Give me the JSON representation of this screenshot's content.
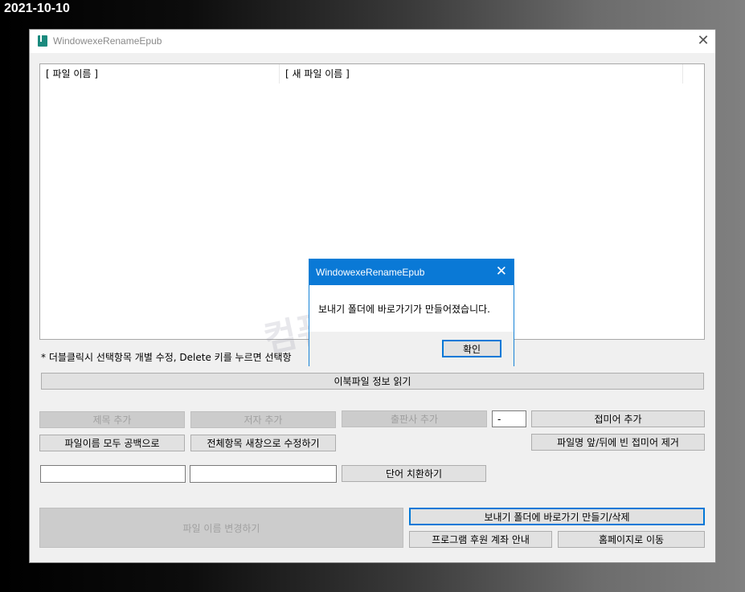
{
  "date_label": "2021-10-10",
  "window": {
    "title": "WindowexeRenameEpub",
    "close_glyph": "✕"
  },
  "listview": {
    "columns": [
      "[ 파일 이름 ]",
      "[ 새 파일 이름 ]"
    ]
  },
  "hint_text": "* 더블클릭시 선택항목 개별 수정, Delete 키를 누르면 선택항",
  "buttons": {
    "read_ebook_info": "이북파일 정보 읽기",
    "add_title": "제목 추가",
    "add_author": "저자 추가",
    "add_publisher": "출판사 추가",
    "add_suffix": "접미어 추가",
    "all_spaces": "파일이름 모두 공백으로",
    "edit_all_new_window": "전체항목 새창으로 수정하기",
    "remove_empty_suffix": "파일명 앞/뒤에 빈 접미어 제거",
    "replace_word": "단어 치환하기",
    "rename_files": "파일 이름 변경하기",
    "sendto_shortcut": "보내기 폴더에 바로가기 만들기/삭제",
    "donation_info": "프로그램 후원 계좌 안내",
    "go_homepage": "홈페이지로 이동"
  },
  "inputs": {
    "separator_value": "-",
    "find_value": "",
    "replace_value": ""
  },
  "watermark": "컴퓨터 관련 정보",
  "dialog": {
    "title": "WindowexeRenameEpub",
    "message": "보내기 폴더에 바로가기가 만들어졌습니다.",
    "ok_label": "확인",
    "close_glyph": "✕"
  },
  "colors": {
    "dialog_title_bg": "#0a79d6",
    "focus_border": "#0078d7",
    "app_icon": "#1a8a7e"
  }
}
